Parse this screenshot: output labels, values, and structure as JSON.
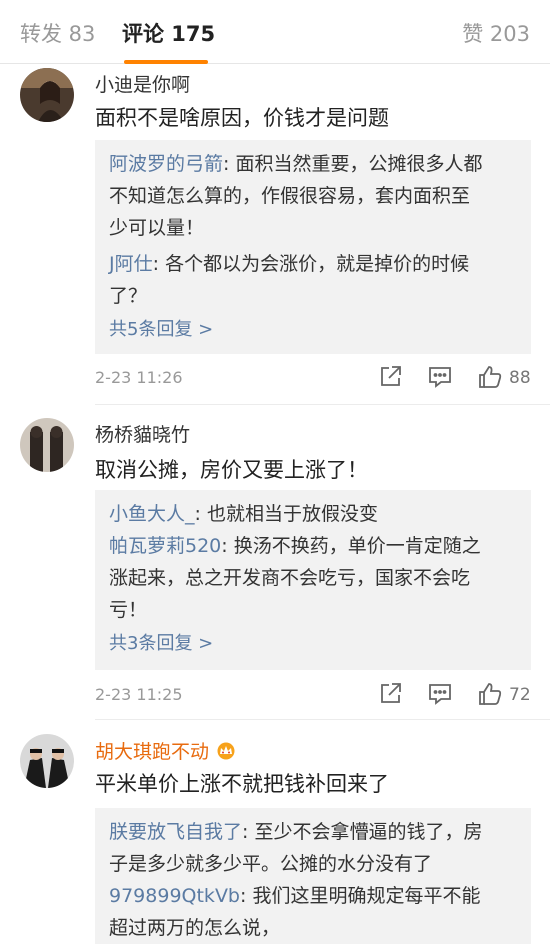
{
  "tabs": {
    "repost": "转发 83",
    "comments": "评论 175",
    "likes": "赞 203"
  },
  "comments": [
    {
      "user": "小迪是你啊",
      "text": "面积不是啥原因，价钱才是问题",
      "replies": [
        {
          "name": "阿波罗的弓箭",
          "lines": [
            "面积当然重要，公摊很多人都",
            "不知道怎么算的，作假很容易，套内面积至",
            "少可以量！"
          ]
        },
        {
          "name": "J阿仕",
          "lines": [
            "各个都以为会涨价，就是掉价的时候",
            "了？"
          ]
        }
      ],
      "more": "共5条回复 >",
      "time": "2-23 11:26",
      "likes": "88"
    },
    {
      "user": "杨桥貓晓竹",
      "text": "取消公摊，房价又要上涨了！",
      "replies": [
        {
          "name": "小鱼大人_",
          "lines": [
            "也就相当于放假没变"
          ]
        },
        {
          "name": "帕瓦萝莉520",
          "lines": [
            "换汤不换药，单价一肯定随之",
            "涨起来，总之开发商不会吃亏，国家不会吃",
            "亏！"
          ]
        }
      ],
      "more": "共3条回复 >",
      "time": "2-23 11:25",
      "likes": "72"
    },
    {
      "user": "胡大琪跑不动",
      "text": "平米单价上涨不就把钱补回来了",
      "replies": [
        {
          "name": "朕要放飞自我了",
          "lines": [
            "至少不会拿懵逼的钱了，房",
            "子是多少就多少平。公摊的水分没有了"
          ]
        },
        {
          "name": "979899QtkVb",
          "lines": [
            "我们这里明确规定每平不能",
            "超过两万的怎么说，"
          ]
        }
      ]
    }
  ],
  "colors": {
    "accent": "#ff8200",
    "reply_name": "#5b7ba3",
    "reply_bg": "#f2f2f2",
    "vip_name": "#e86b0f"
  }
}
